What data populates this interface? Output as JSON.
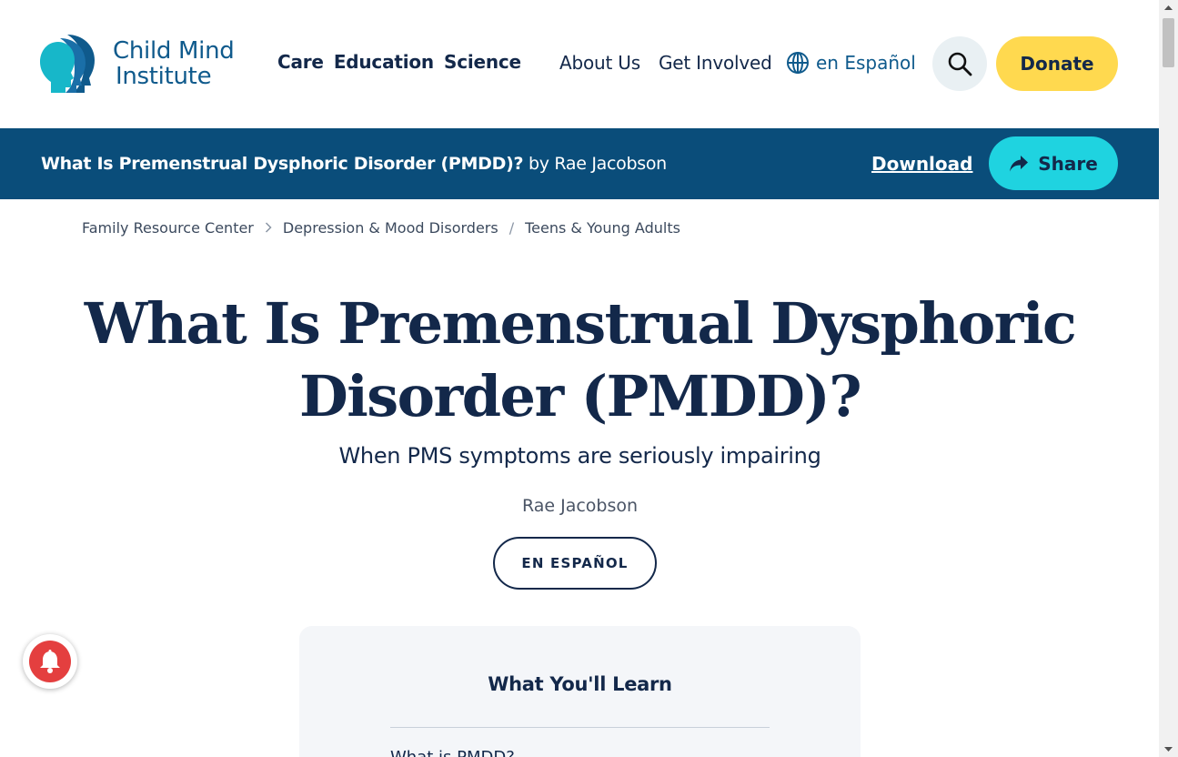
{
  "header": {
    "logo": {
      "line1": "Child Mind",
      "line2": "Institute"
    },
    "primary_nav": [
      "Care",
      "Education",
      "Science"
    ],
    "secondary_nav": [
      "About Us",
      "Get Involved"
    ],
    "language_link": "en Español",
    "search_icon": "search-icon",
    "donate_label": "Donate"
  },
  "article_bar": {
    "title": "What Is Premenstrual Dysphoric Disorder (PMDD)?",
    "byline": "by Rae Jacobson",
    "download_label": "Download",
    "share_label": "Share"
  },
  "breadcrumb": [
    "Family Resource Center",
    "Depression & Mood Disorders",
    "Teens & Young Adults"
  ],
  "article": {
    "headline_line1": "What Is Premenstrual Dysphoric",
    "headline_line2": "Disorder (PMDD)?",
    "dek": "When PMS symptoms are seriously impairing",
    "author": "Rae Jacobson",
    "spanish_button": "EN ESPAÑOL"
  },
  "learn": {
    "title": "What You'll Learn",
    "first_item": "What is PMDD?"
  },
  "colors": {
    "navy": "#13284a",
    "brand_blue": "#0a4d7a",
    "share_cyan": "#1fd3e0",
    "donate_yellow": "#ffd94f",
    "bell_red": "#e43f3f"
  }
}
